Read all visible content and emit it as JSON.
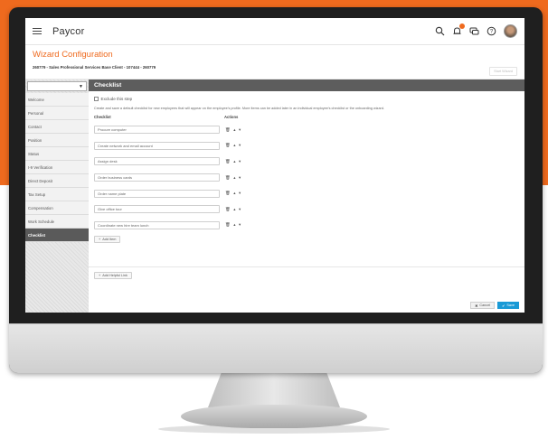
{
  "app": {
    "logo": "Paycor"
  },
  "page": {
    "title": "Wizard Configuration",
    "subtitle": "260779 - Sales Professional Services Base Client - 107444 - 260779",
    "start_wizard": "Start Wizard"
  },
  "sidebar": {
    "select_value": "▼",
    "items": [
      {
        "label": "Welcome"
      },
      {
        "label": "Personal"
      },
      {
        "label": "Contact"
      },
      {
        "label": "Position"
      },
      {
        "label": "Status"
      },
      {
        "label": "I-9 Verification"
      },
      {
        "label": "Direct Deposit"
      },
      {
        "label": "Tax Setup"
      },
      {
        "label": "Compensation"
      },
      {
        "label": "Work Schedule"
      },
      {
        "label": "Checklist"
      }
    ]
  },
  "section": {
    "title": "Checklist",
    "exclude_label": "Exclude this step",
    "description": "Create and save a default checklist for new employees that will appear on the employee's profile. More items can be added later in an individual employee's checklist or the onboarding wizard.",
    "col_checklist": "Checklist",
    "col_actions": "Actions",
    "rows": [
      {
        "value": "Procure computer"
      },
      {
        "value": "Create network and email account"
      },
      {
        "label_hidden": "",
        "value": "Assign desk"
      },
      {
        "value": "Order business cards"
      },
      {
        "value": "Order name plate"
      },
      {
        "value": "Give office tour"
      },
      {
        "value": "Coordinate new hire team lunch"
      }
    ],
    "add_item": "Add Item",
    "add_link": "Add Helpful Link"
  },
  "footer": {
    "cancel": "Cancel",
    "save": "Save"
  },
  "colors": {
    "accent": "#ef6a1e",
    "header_bar": "#5d5d5d",
    "save": "#1a9ad6"
  }
}
